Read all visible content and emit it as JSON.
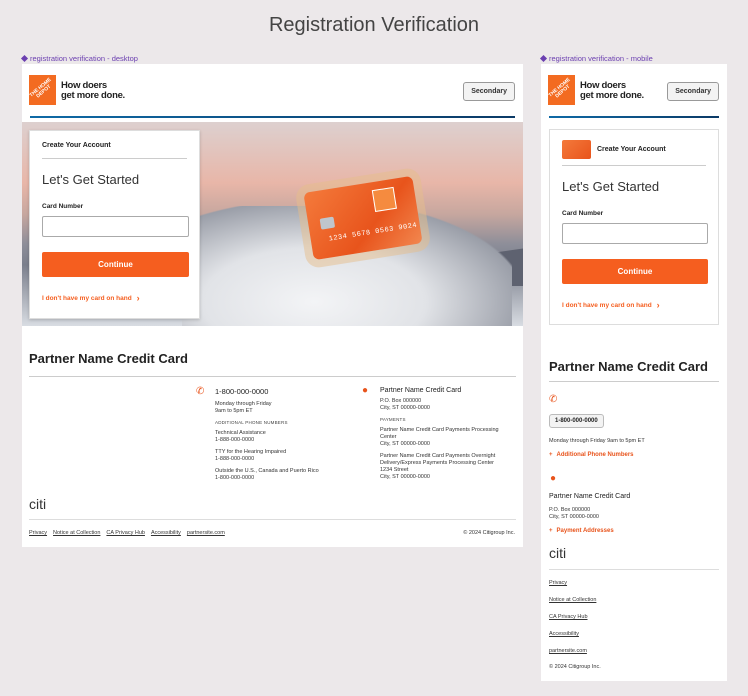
{
  "page_title": "Registration Verification",
  "desktop": {
    "frame_label": "registration verification - desktop",
    "header": {
      "tagline_line1": "How doers",
      "tagline_line2": "get more done.",
      "secondary_label": "Secondary",
      "logo_text": "THE HOME DEPOT"
    },
    "card_number_display": "1234 5678 0563 9024",
    "form": {
      "title": "Create Your Account",
      "heading": "Let's Get Started",
      "card_label": "Card Number",
      "card_value": "",
      "continue_label": "Continue",
      "no_card_link": "I don't have my card on hand"
    },
    "partner": {
      "title": "Partner Name Credit Card",
      "phone": "1-800-000-0000",
      "hours_line1": "Monday through Friday",
      "hours_line2": "9am to 5pm ET",
      "additional_caption": "ADDITIONAL PHONE NUMBERS",
      "tech_label": "Technical Assistance",
      "tech_phone": "1-888-000-0000",
      "tty_label": "TTY for the Hearing Impaired",
      "tty_phone": "1-888-000-0000",
      "outside_label": "Outside the U.S., Canada and Puerto Rico",
      "outside_phone": "1-800-000-0000",
      "addr_name": "Partner Name Credit Card",
      "addr_line1": "P.O. Box 000000",
      "addr_line2": "City, ST 00000-0000",
      "payments_caption": "PAYMENTS",
      "pay_name": "Partner Name Credit Card Payments Processing Center",
      "pay_city": "City, ST 00000-0000",
      "overnight_name": "Partner Name Credit Card Payments Overnight Delivery/Express Payments Processing Center",
      "overnight_street": "1234 Street",
      "overnight_city": "City, ST 00000-0000"
    },
    "citi": "citi",
    "footer": {
      "links": [
        "Privacy",
        "Notice at Collection",
        "CA Privacy Hub",
        "Accessibility",
        "partnersite.com"
      ],
      "copyright": "© 2024 Citigroup Inc."
    }
  },
  "mobile": {
    "frame_label": "registration verification - mobile",
    "header": {
      "tagline_line1": "How doers",
      "tagline_line2": "get more done.",
      "secondary_label": "Secondary",
      "logo_text": "THE HOME DEPOT"
    },
    "form": {
      "title": "Create Your Account",
      "heading": "Let's Get Started",
      "card_label": "Card Number",
      "card_value": "",
      "continue_label": "Continue",
      "no_card_link": "I don't have my card on hand"
    },
    "partner": {
      "title": "Partner Name Credit Card",
      "phone": "1-800-000-0000",
      "hours": "Monday through Friday 9am to 5pm ET",
      "additional_link": "Additional Phone Numbers",
      "addr_name": "Partner Name Credit Card",
      "addr_line1": "P.O. Box 000000",
      "addr_line2": "City, ST 00000-0000",
      "payment_link": "Payment Addresses"
    },
    "citi": "citi",
    "footer": {
      "links": [
        "Privacy",
        "Notice at Collection",
        "CA Privacy Hub",
        "Accessibility",
        "partnersite.com"
      ],
      "copyright": "© 2024 Citigroup Inc."
    }
  }
}
